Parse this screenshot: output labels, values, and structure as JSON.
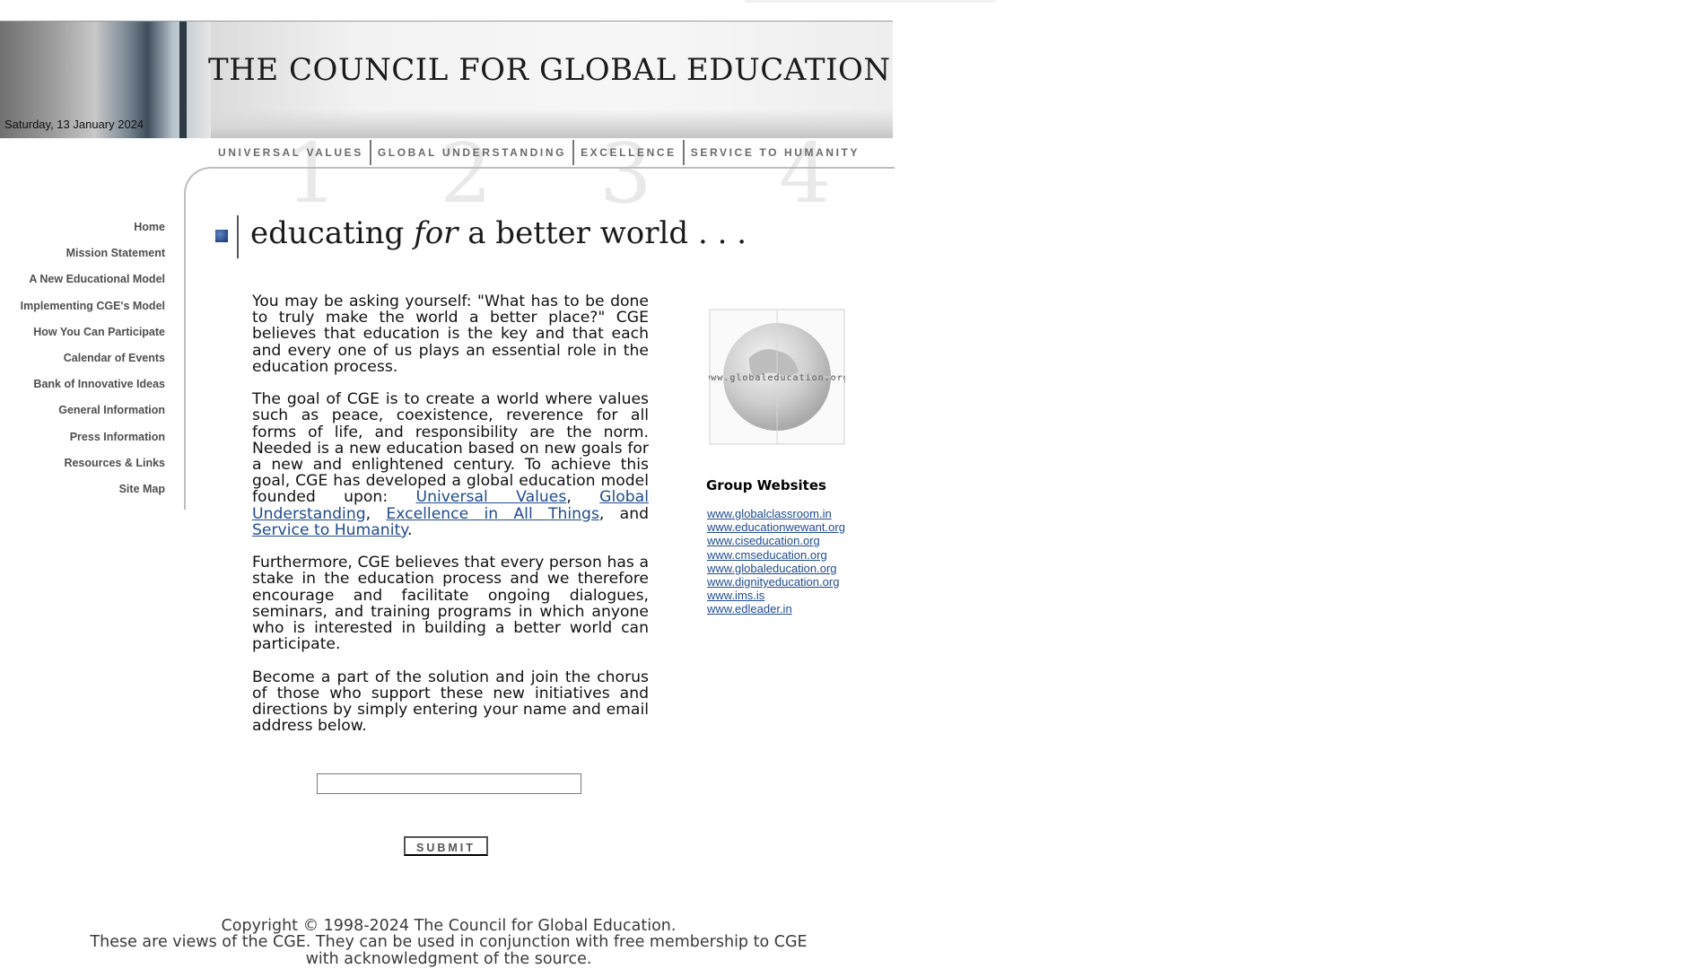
{
  "header": {
    "site_title": "THE COUNCIL FOR GLOBAL EDUCATION",
    "date": "Saturday, 13 January 2024",
    "ghost_numbers": [
      "1",
      "2",
      "3",
      "4"
    ]
  },
  "values_strip": [
    "UNIVERSAL VALUES",
    "GLOBAL UNDERSTANDING",
    "EXCELLENCE",
    "SERVICE TO HUMANITY"
  ],
  "left_nav": [
    "Home",
    "Mission Statement",
    "A New Educational Model",
    "Implementing CGE's Model",
    "How You Can Participate",
    "Calendar of Events",
    "Bank of Innovative Ideas",
    "General Information",
    "Press Information",
    "Resources & Links",
    "Site Map"
  ],
  "tagline": {
    "part1": "educating ",
    "part2": "for",
    "part3": " a better world . . ."
  },
  "main": {
    "p1": "You may be asking yourself: \"What has to be done to truly make the world a better place?\" CGE believes that education is the key and that each and every one of us plays an essential role in the education process.",
    "p2_text": "The goal of CGE is to create a world where values such as peace, coexistence, reverence for all forms of life, and responsibility are the norm. Needed is a new education based on new goals for a new and enlightened century. To achieve this goal, CGE has developed a global education model founded upon: ",
    "p2_link1": "Universal Values",
    "p2_sep1": ", ",
    "p2_link2": "Global Understanding",
    "p2_sep2": ", ",
    "p2_link3": "Excellence in All Things",
    "p2_sep3": ", and ",
    "p2_link4": "Service to Humanity",
    "p2_end": ".",
    "p3": "Furthermore, CGE believes that every person has a stake in the education process and we therefore encourage and facilitate ongoing dialogues, seminars, and training programs in which anyone who is interested in building a better world can participate.",
    "p4": "Become a part of the solution and join the chorus of those who support these new initiatives and directions by simply entering your name and email address below.",
    "email_value": "",
    "submit_label": "SUBMIT"
  },
  "right": {
    "logo_text": "www.globaleducation.org",
    "group_heading": "Group Websites",
    "group_links": [
      "www.globalclassroom.in",
      "www.educationwewant.org",
      "www.ciseducation.org",
      "www.cmseducation.org",
      "www.globaleducation.org",
      "www.dignityeducation.org",
      "www.ims.is",
      "www.edleader.in"
    ]
  },
  "footer": {
    "line1": "Copyright © 1998-2024 The Council for Global Education.",
    "line2": "These are views of the CGE. They can be used in conjunction with free membership to CGE",
    "line3": "with acknowledgment of the source."
  },
  "colors": {
    "link": "#1f4b8f",
    "nav_text": "#4f4f4f",
    "bullet": "#12326e"
  }
}
